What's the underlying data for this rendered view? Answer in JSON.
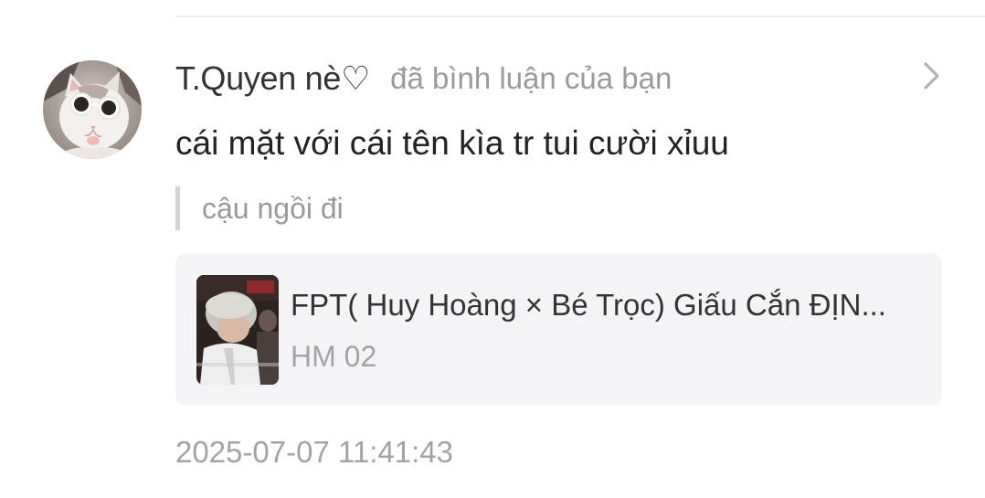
{
  "notification": {
    "user_name": "T.Quyen nè♡",
    "action_text": "đã bình luận của bạn",
    "comment_text": "cái mặt với cái tên kìa tr tui cười xỉuu",
    "quoted_reply": "cậu ngồi đi",
    "video": {
      "title": "FPT( Huy Hoàng × Bé Trọc) Giấu Cắn ĐỊN...",
      "author": "HM 02"
    },
    "timestamp": "2025-07-07 11:41:43"
  },
  "icons": {
    "chevron": "chevron-right-icon",
    "avatar": "cat-with-sunglasses-avatar",
    "thumbnail": "video-thumbnail"
  },
  "colors": {
    "primary_text": "#333333",
    "secondary_text": "#9a9a9a",
    "card_background": "#f4f4f6",
    "quote_bar": "#d3d3d3"
  }
}
